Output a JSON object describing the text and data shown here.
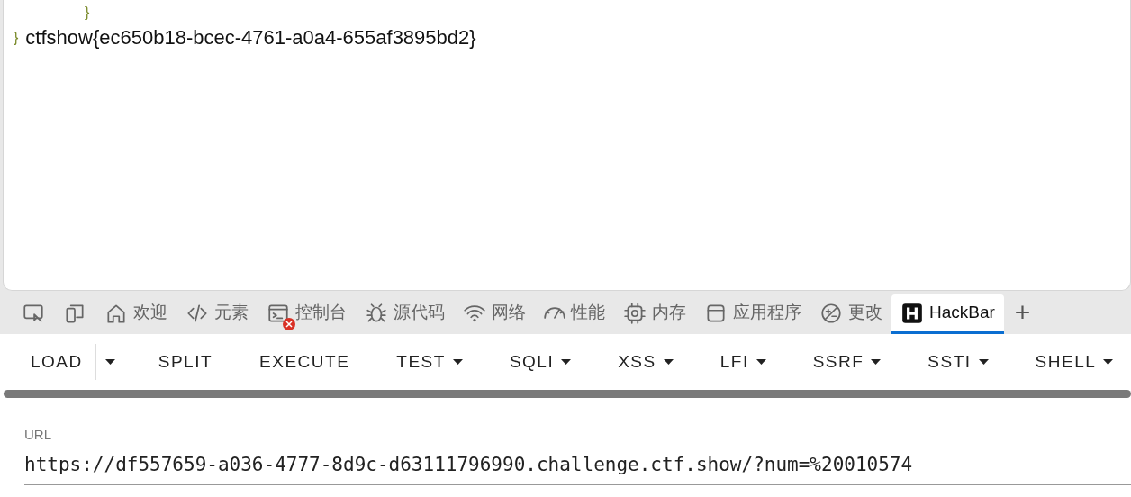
{
  "page": {
    "lines": [
      {
        "brace": "}",
        "indented": true
      },
      {
        "brace": "}",
        "indented": false,
        "text": "ctfshow{ec650b18-bcec-4761-a0a4-655af3895bd2}"
      }
    ]
  },
  "devtools_tabs": [
    {
      "kind": "inspect",
      "selected": false,
      "error_badge": false
    },
    {
      "kind": "device",
      "selected": false,
      "error_badge": false
    },
    {
      "kind": "home",
      "label": "欢迎",
      "selected": false,
      "error_badge": false
    },
    {
      "kind": "code",
      "label": "元素",
      "selected": false,
      "error_badge": false
    },
    {
      "kind": "console",
      "label": "控制台",
      "selected": false,
      "error_badge": true
    },
    {
      "kind": "bug",
      "label": "源代码",
      "selected": false,
      "error_badge": false
    },
    {
      "kind": "wifi",
      "label": "网络",
      "selected": false,
      "error_badge": false
    },
    {
      "kind": "gauge",
      "label": "性能",
      "selected": false,
      "error_badge": false
    },
    {
      "kind": "chip",
      "label": "内存",
      "selected": false,
      "error_badge": false
    },
    {
      "kind": "window",
      "label": "应用程序",
      "selected": false,
      "error_badge": false
    },
    {
      "kind": "diff",
      "label": "更改",
      "selected": false,
      "error_badge": false
    },
    {
      "kind": "hackbar",
      "label": "HackBar",
      "selected": true,
      "error_badge": false
    }
  ],
  "add_tab": "+",
  "hackbar_buttons": [
    {
      "label": "LOAD",
      "kind": "split"
    },
    {
      "label": "SPLIT",
      "kind": "plain"
    },
    {
      "label": "EXECUTE",
      "kind": "plain"
    },
    {
      "label": "TEST",
      "kind": "dropdown"
    },
    {
      "label": "SQLI",
      "kind": "dropdown"
    },
    {
      "label": "XSS",
      "kind": "dropdown"
    },
    {
      "label": "LFI",
      "kind": "dropdown"
    },
    {
      "label": "SSRF",
      "kind": "dropdown"
    },
    {
      "label": "SSTI",
      "kind": "dropdown"
    },
    {
      "label": "SHELL",
      "kind": "dropdown"
    }
  ],
  "url_field": {
    "label": "URL",
    "value": "https://df557659-a036-4777-8d9c-d63111796990.challenge.ctf.show/?num=%20010574"
  }
}
